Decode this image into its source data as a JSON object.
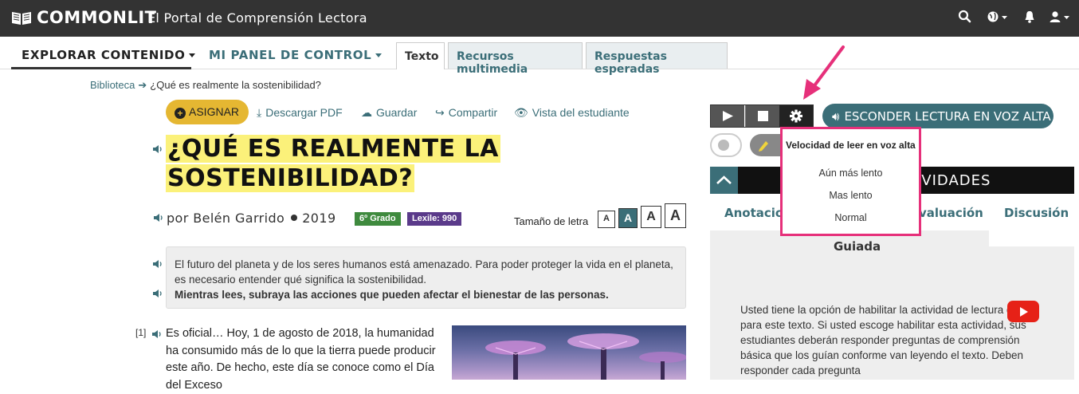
{
  "topbar": {
    "brand": "COMMONLIT",
    "subtitle": "El Portal de Comprensión Lectora",
    "icons": [
      "book-logo-icon",
      "search-icon",
      "globe-icon",
      "bell-icon",
      "user-icon"
    ]
  },
  "nav": {
    "explore": "EXPLORAR CONTENIDO",
    "dashboard": "MI PANEL DE CONTROL",
    "tabs": [
      {
        "label": "Texto",
        "active": true
      },
      {
        "label": "Recursos multimedia",
        "active": false
      },
      {
        "label": "Respuestas esperadas",
        "active": false
      }
    ]
  },
  "breadcrumb": {
    "library": "Biblioteca",
    "current": "¿Qué es realmente la sostenibilidad?"
  },
  "actions": {
    "assign": "ASIGNAR",
    "download": "Descargar PDF",
    "save": "Guardar",
    "share": "Compartir",
    "student_view": "Vista del estudiante"
  },
  "article": {
    "title_line1": "¿QUÉ ES REALMENTE LA",
    "title_line2": "SOSTENIBILIDAD?",
    "byline": "por Belén Garrido",
    "year": "2019",
    "grade": "6º Grado",
    "lexile": "Lexile: 990",
    "font_size_label": "Tamaño de letra",
    "font_sizes": [
      "A",
      "A",
      "A",
      "A"
    ],
    "intro_line1": "El futuro del planeta y de los seres humanos está amenazado. Para poder proteger la vida en el planeta,",
    "intro_line2": "es necesario entender qué significa la sostenibilidad.",
    "intro_bold": "Mientras lees, subraya las acciones que pueden afectar el bienestar de las personas.",
    "para_number": "[1]",
    "para_text": "Es oficial… Hoy, 1 de agosto de 2018, la humanidad ha consumido más de lo que la tierra puede producir este año. De hecho, este día se conoce como el Día del Exceso"
  },
  "reader": {
    "esconder": "ESCONDER LECTURA EN VOZ ALTA",
    "dropdown_title": "Velocidad de leer en voz alta",
    "speeds": [
      "Aún más lento",
      "Mas lento",
      "Normal"
    ]
  },
  "right_panel": {
    "activities_partial": "IVIDADES",
    "tab_annotations": "Anotacion",
    "tab_evaluation": "valuación",
    "tab_discussion": "Discusión",
    "guided": "Guiada",
    "body": "Usted tiene la opción de habilitar la actividad de lectura guiada para este texto. Si usted escoge habilitar esta actividad, sus estudiantes deberán responder preguntas de comprensión básica que los guían conforme van leyendo el texto. Deben responder cada pregunta"
  },
  "colors": {
    "teal": "#3b6e78",
    "gold": "#e5b732",
    "highlight": "#fbf17a",
    "grade_green": "#3f8a3e",
    "lexile_purple": "#5a3a8a",
    "annotation_pink": "#e6307a"
  }
}
